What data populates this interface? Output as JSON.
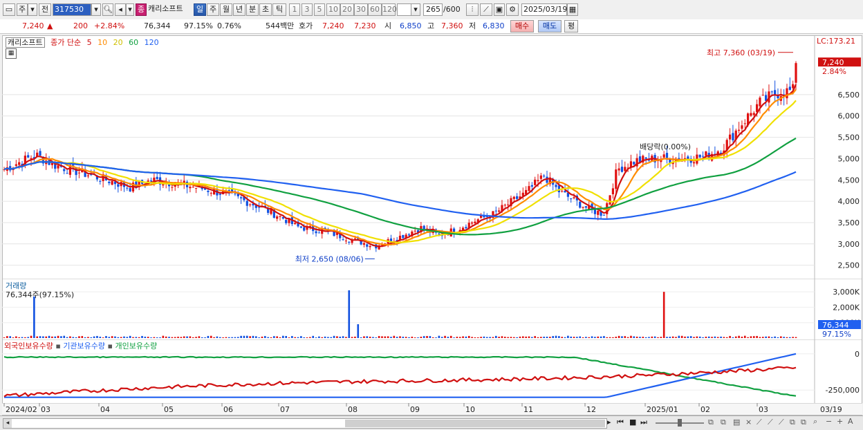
{
  "toolbar": {
    "type1": "주",
    "type2": "전",
    "code": "317530",
    "badge": "종",
    "name": "캐리소프트",
    "periods": [
      "일",
      "주",
      "월",
      "년",
      "분",
      "초",
      "틱"
    ],
    "active_period": "일",
    "intervals": [
      "1",
      "3",
      "5",
      "10",
      "20",
      "30",
      "60",
      "120"
    ],
    "count_value": "265",
    "count_total": "/600",
    "date": "2025/03/19"
  },
  "quote": {
    "price": "7,240",
    "change": "200",
    "change_pct": "+2.84%",
    "volume": "76,344",
    "volume_ratio": "97.15%",
    "turnover": "0.76%",
    "amount": "544백만",
    "ask_label": "호가",
    "ask": "7,240",
    "bid": "7,230",
    "open_label": "시",
    "open": "6,850",
    "high_label": "고",
    "high": "7,360",
    "low_label": "저",
    "low": "6,830",
    "buy_btn": "매수",
    "sell_btn": "매도",
    "eval_btn": "평"
  },
  "price_panel": {
    "legend_name": "캐리소프트",
    "legend_type": "종가 단순",
    "ma_labels": [
      "5",
      "10",
      "20",
      "60",
      "120"
    ],
    "ma_colors": [
      "#d01010",
      "#ff8c00",
      "#f0e000",
      "#10a040",
      "#2060f0"
    ],
    "y_ticks": [
      "6,500",
      "6,000",
      "5,500",
      "5,000",
      "4,500",
      "4,000",
      "3,500",
      "3,000",
      "2,500"
    ],
    "lc_label": "LC:173.21",
    "current_price_tag": "7,240",
    "current_pct_tag": "2.84%",
    "max_annotation": "최고 7,360 (03/19)",
    "min_annotation": "최저 2,650 (08/06)",
    "event_annotation": "배당락(0.00%)"
  },
  "volume_panel": {
    "title": "거래량",
    "value_line": "76,344주(97.15%)",
    "y_ticks": [
      "3,000K",
      "2,000K",
      "1,000K"
    ],
    "current_tag": "76,344",
    "current_pct": "97.15%"
  },
  "holding_panel": {
    "legend": [
      "외국인보유수량",
      "기관보유수량",
      "개인보유수량"
    ],
    "legend_colors": [
      "#d01010",
      "#2060f0",
      "#10a040"
    ],
    "y_ticks": [
      "0",
      "-250,000"
    ]
  },
  "x_axis": {
    "labels": [
      "2024/02",
      "03",
      "04",
      "05",
      "06",
      "07",
      "08",
      "09",
      "10",
      "11",
      "12",
      "2025/01",
      "02",
      "03"
    ],
    "end_label": "03/19"
  },
  "chart_data": {
    "type": "candlestick",
    "ma_periods": [
      5,
      10,
      20,
      60,
      120
    ],
    "max": {
      "price": 7360,
      "date": "03/19"
    },
    "min": {
      "price": 2650,
      "date": "08/06"
    },
    "last": {
      "price": 7240,
      "change_pct": 2.84,
      "volume": 76344
    },
    "price_ylim": [
      2300,
      7600
    ],
    "volume_ylim": [
      0,
      3500000
    ],
    "holding_ylim": [
      -330000,
      80000
    ]
  }
}
